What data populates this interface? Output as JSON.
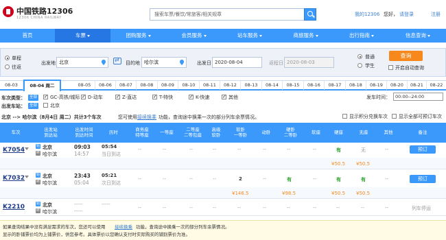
{
  "header": {
    "logo_cn": "中国铁路12306",
    "logo_en": "12306 CHINA RAILWAY",
    "search_placeholder": "搜索车票/餐饮/常旅客/相关规章",
    "my_account": "我的12306",
    "greeting": "您好，",
    "login": "请登录",
    "register": "注册"
  },
  "nav": [
    {
      "label": "首页",
      "active": false,
      "caret": false
    },
    {
      "label": "车票",
      "active": true,
      "caret": true
    },
    {
      "label": "团购服务",
      "active": false,
      "caret": true
    },
    {
      "label": "会员服务",
      "active": false,
      "caret": true
    },
    {
      "label": "站车服务",
      "active": false,
      "caret": true
    },
    {
      "label": "商旅服务",
      "active": false,
      "caret": true
    },
    {
      "label": "出行指南",
      "active": false,
      "caret": true
    },
    {
      "label": "信息查询",
      "active": false,
      "caret": true
    }
  ],
  "query": {
    "trip_oneway": "单程",
    "trip_round": "往返",
    "from_label": "出发地",
    "from_value": "北京",
    "to_label": "目的地",
    "to_value": "哈尔滨",
    "depart_label": "出发日",
    "depart_value": "2020-08-04",
    "return_label": "返程日",
    "return_value": "2020-08-03",
    "type_normal": "普通",
    "type_student": "学生",
    "query_button": "查询",
    "auto_query": "开启自动查询"
  },
  "dates": [
    "08-03",
    "08-04 周二",
    "08-05",
    "08-06",
    "08-07",
    "08-08",
    "08-09",
    "08-10",
    "08-11",
    "08-12",
    "08-13",
    "08-14",
    "08-15",
    "08-16",
    "08-17",
    "08-18",
    "08-19",
    "08-20",
    "08-21",
    "08-22"
  ],
  "filter": {
    "type_label": "车次类型：",
    "all_tag": "全部",
    "types": [
      "GC-高铁/城际",
      "D-动车",
      "Z-直达",
      "T-特快",
      "K-快速",
      "其他"
    ],
    "station_label": "出发车站：",
    "station": "北京",
    "time_label": "发车时间：",
    "time_value": "00:00--24:00"
  },
  "summary": {
    "route": "北京 --> 哈尔滨（8月4日 周二）共计3个车次",
    "tip_pre": "您可使用",
    "tip_link": "接续换乘",
    "tip_post": "功能，查询途中换乘一次的部分列车余票情况。",
    "points_check": "显示积分兑换车次",
    "all_check": "显示全部可预订车次"
  },
  "columns": [
    "车次",
    "出发站\n到达站",
    "出发时间\n到达时间",
    "历时",
    "商务座\n特等座",
    "一等座",
    "二等座\n二等包座",
    "高级\n软卧",
    "软卧\n一等卧",
    "动卧",
    "硬卧\n二等卧",
    "软座",
    "硬座",
    "无座",
    "其他",
    "备注"
  ],
  "trains": [
    {
      "no": "K7054",
      "from": "北京",
      "to": "哈尔滨",
      "dep": "09:03",
      "arr": "14:57",
      "duration": "05:54",
      "day_note": "当日到达",
      "seats": [
        "--",
        "--",
        "--",
        "--",
        "--",
        "--",
        "--",
        "--",
        "有",
        "无",
        "--"
      ],
      "prices": [
        "",
        "",
        "",
        "",
        "",
        "",
        "",
        "",
        "¥50.5",
        "¥50.5",
        ""
      ],
      "remark": "预订"
    },
    {
      "no": "K7032",
      "from": "北京",
      "to": "哈尔滨",
      "dep": "23:43",
      "arr": "05:04",
      "duration": "05:21",
      "day_note": "次日到达",
      "seats": [
        "--",
        "--",
        "--",
        "--",
        "2",
        "--",
        "有",
        "--",
        "有",
        "有",
        "--"
      ],
      "prices": [
        "",
        "",
        "",
        "",
        "¥146.5",
        "",
        "¥98.5",
        "",
        "¥50.5",
        "¥50.5",
        ""
      ],
      "remark": "预订"
    },
    {
      "no": "K2210",
      "from": "北京",
      "to": "哈尔滨",
      "dep": "-----",
      "arr": "-----",
      "duration": "-----",
      "day_note": "",
      "seats": [
        "--",
        "--",
        "--",
        "--",
        "--",
        "--",
        "--",
        "--",
        "--",
        "--",
        "--"
      ],
      "prices": [
        "",
        "",
        "",
        "",
        "",
        "",
        "",
        "",
        "",
        "",
        ""
      ],
      "remark": "列车停运"
    }
  ],
  "notice": {
    "line1_pre": "如果查询结果中没有满足需求的车次，您还可以使用",
    "line1_link": "接续换乘",
    "line1_post": "功能，查询途中换乘一次的部分列车余票情况。",
    "line2": "显示的卧铺票价均为上铺票价，供您参考。具体票价以您确认支付时实际购买的铺别票价为准。"
  }
}
